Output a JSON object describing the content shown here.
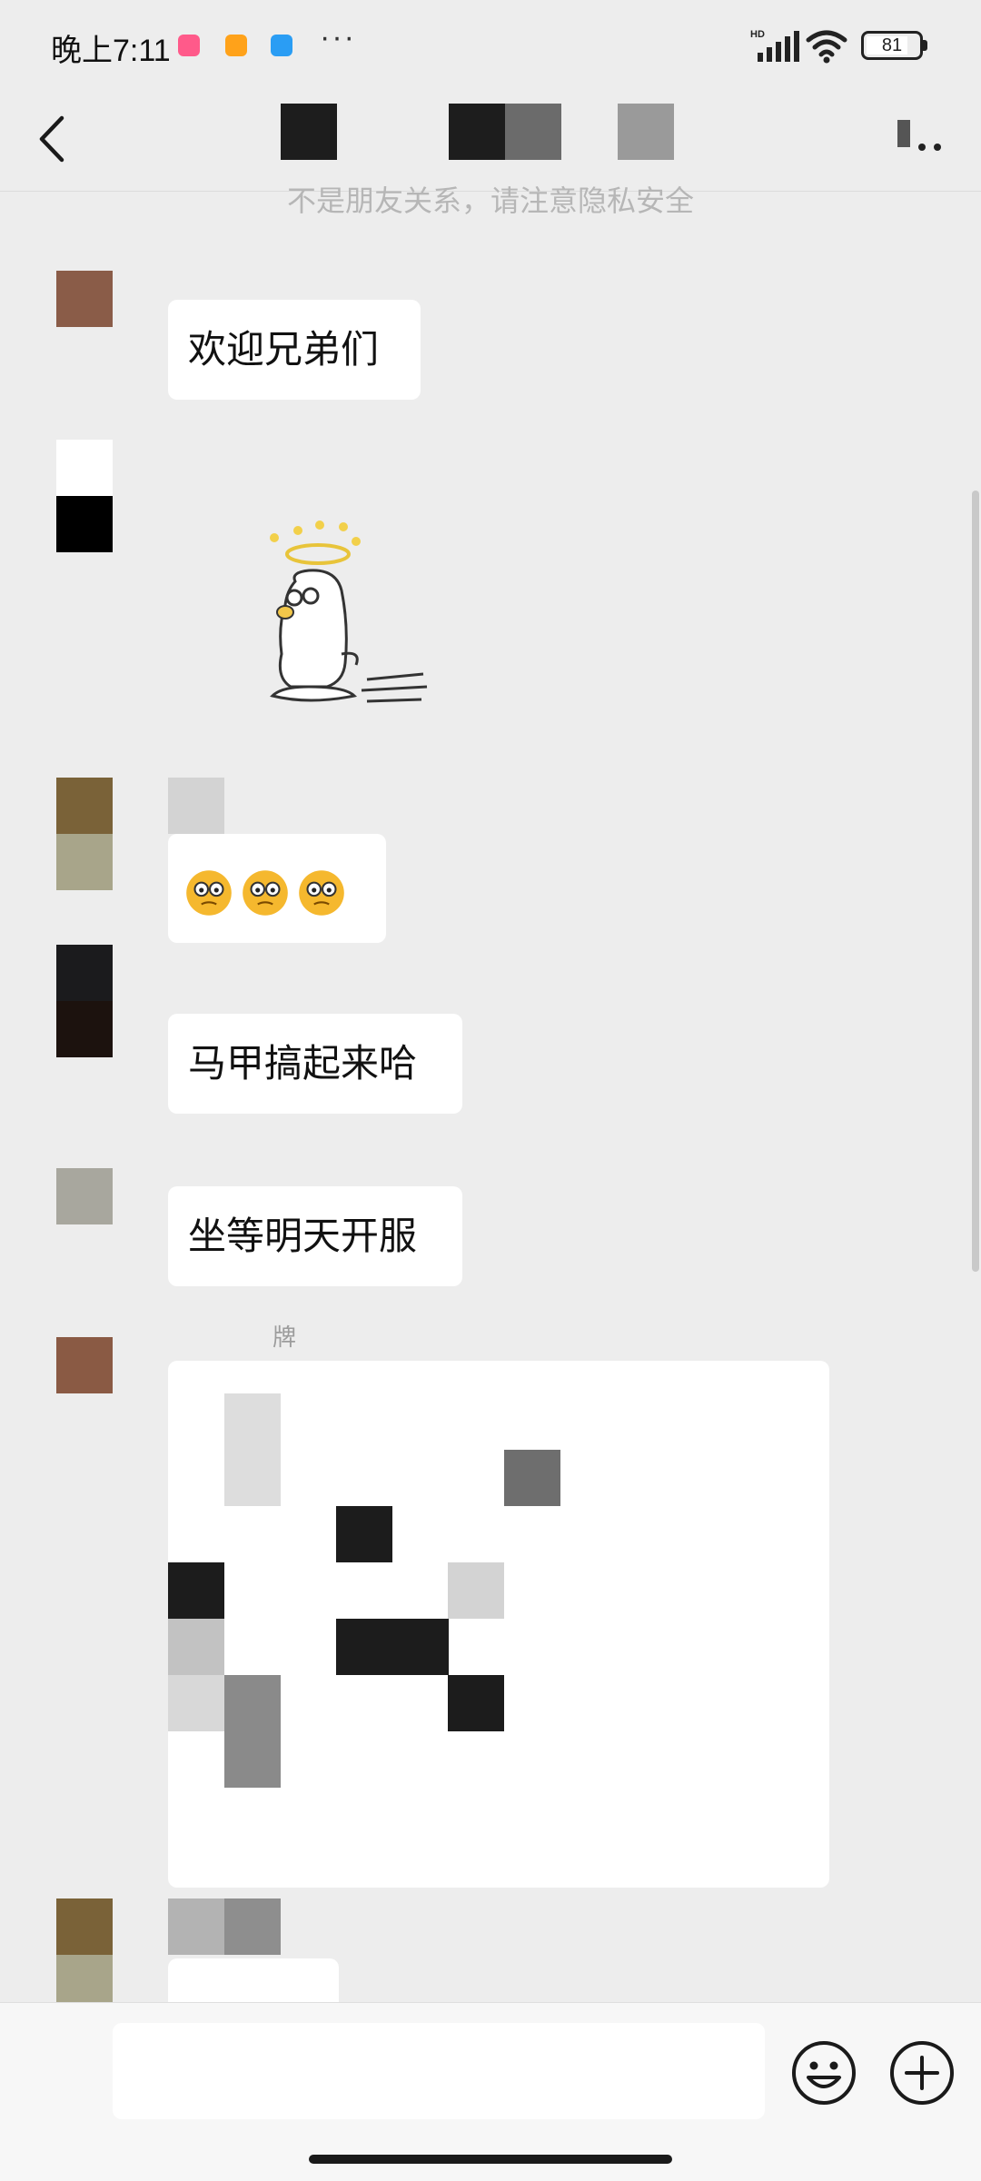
{
  "status_bar": {
    "time": "晚上7:11",
    "more": "···",
    "network": "HD",
    "battery_level": 81,
    "battery_label": "81",
    "app_icon_colors": [
      "#ff5a8a",
      "#ffa21a",
      "#2a9df4"
    ]
  },
  "header": {
    "back_icon": "chevron-left-icon",
    "more_icon": "more-dots-icon"
  },
  "chat": {
    "notice": "不是朋友关系，请注意隐私安全",
    "messages": [
      {
        "type": "text",
        "text": "欢迎兄弟们"
      },
      {
        "type": "sticker",
        "sticker": "dizzy-duck-sticker"
      },
      {
        "type": "emoji",
        "emojis": [
          "🥴",
          "🥴",
          "🥴"
        ]
      },
      {
        "type": "text",
        "text": "马甲搞起来哈"
      },
      {
        "type": "text",
        "text": "坐等明天开服"
      },
      {
        "type": "card",
        "sender_label": "牌"
      }
    ]
  },
  "input_bar": {
    "placeholder": "",
    "emoji_icon": "smiley-icon",
    "plus_icon": "plus-circle-icon"
  },
  "colors": {
    "background": "#ededed",
    "bubble": "#ffffff",
    "input_bar": "#f7f7f7"
  }
}
